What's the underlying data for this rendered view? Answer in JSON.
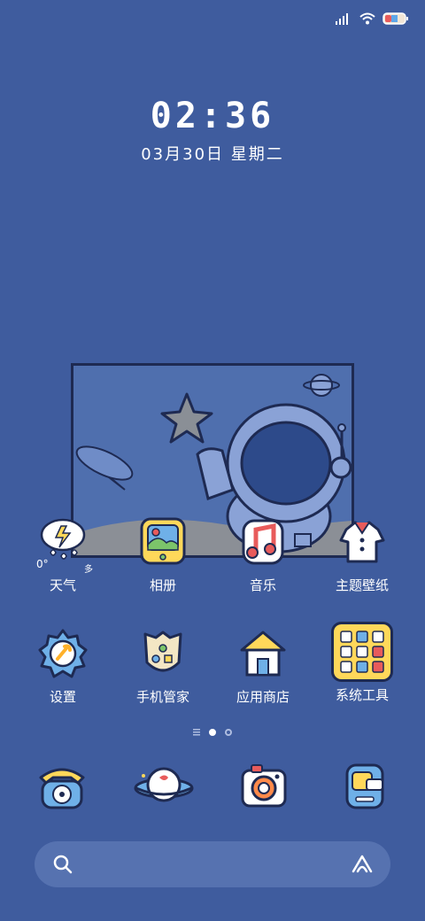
{
  "status_bar": {
    "signal_icon": "signal-icon",
    "wifi_icon": "wifi-icon",
    "battery_icon": "battery-icon",
    "battery_level": 0.5
  },
  "lock": {
    "time": "02:36",
    "date": "03月30日  星期二"
  },
  "weather": {
    "temp": "0°",
    "condition": "多"
  },
  "apps_row1": [
    {
      "label": "天气",
      "icon": "weather-icon"
    },
    {
      "label": "相册",
      "icon": "gallery-icon"
    },
    {
      "label": "音乐",
      "icon": "music-icon"
    },
    {
      "label": "主题壁纸",
      "icon": "theme-icon"
    }
  ],
  "apps_row2": [
    {
      "label": "设置",
      "icon": "settings-icon"
    },
    {
      "label": "手机管家",
      "icon": "security-icon"
    },
    {
      "label": "应用商店",
      "icon": "app-store-icon"
    },
    {
      "label": "系统工具",
      "icon": "system-tools-folder-icon"
    }
  ],
  "dock": [
    {
      "icon": "phone-icon"
    },
    {
      "icon": "browser-planet-icon"
    },
    {
      "icon": "camera-icon"
    },
    {
      "icon": "messages-icon"
    }
  ],
  "search": {
    "search_icon": "search-icon",
    "assistant_icon": "assistant-icon"
  },
  "colors": {
    "background": "#3f5c9e",
    "outline": "#1e2a52",
    "accent_yellow": "#ffd85a",
    "accent_red": "#e85b5b"
  }
}
